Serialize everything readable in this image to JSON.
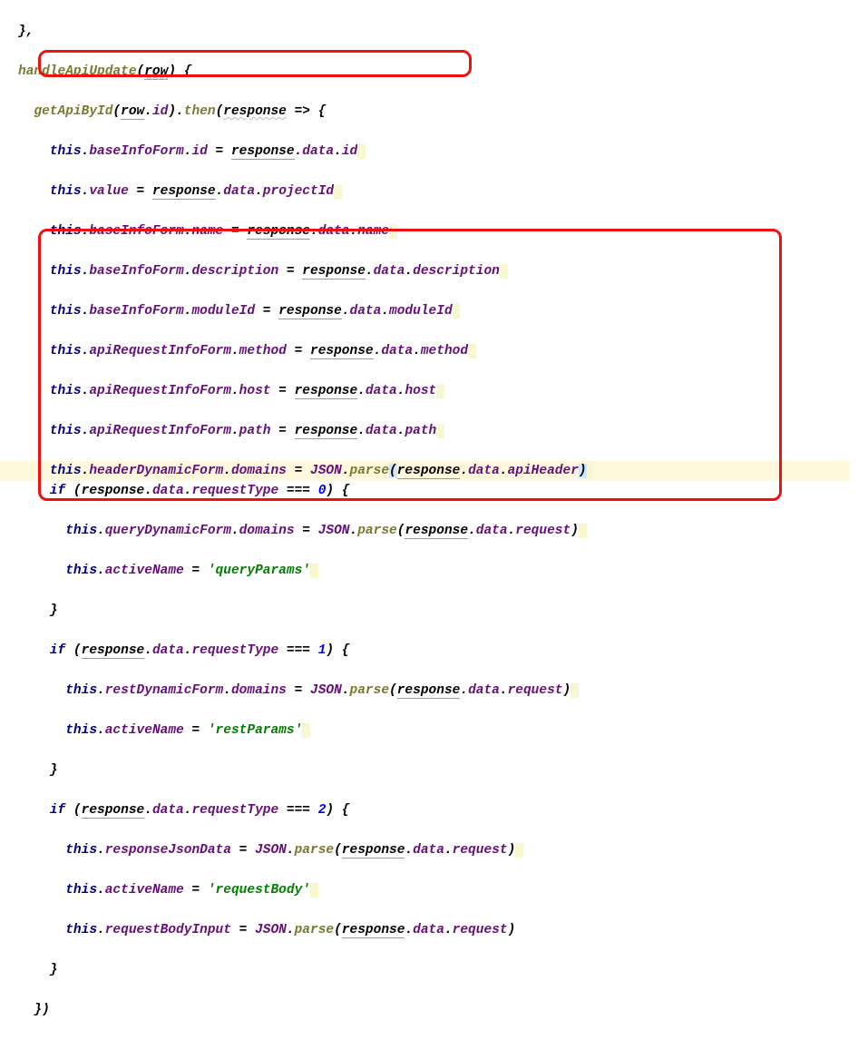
{
  "code": {
    "l0": "},",
    "l1_fn": "handleApiUpdate",
    "l1_arg": "row",
    "l2_fn": "getApiById",
    "l2_arg": "row",
    "l2_prop": "id",
    "l2_then": "then",
    "l2_resp": "response",
    "l3_this": "this",
    "l3_p1": "baseInfoForm",
    "l3_p2": "id",
    "l3_r": "response",
    "l3_rp1": "data",
    "l3_rp2": "id",
    "l4_this": "this",
    "l4_p1": "value",
    "l4_r": "response",
    "l4_rp1": "data",
    "l4_rp2": "projectId",
    "l5_this": "this",
    "l5_p1": "baseInfoForm",
    "l5_p2": "name",
    "l5_r": "response",
    "l5_rp1": "data",
    "l5_rp2": "name",
    "l6_this": "this",
    "l6_p1": "baseInfoForm",
    "l6_p2": "description",
    "l6_r": "response",
    "l6_rp1": "data",
    "l6_rp2": "description",
    "l7_this": "this",
    "l7_p1": "baseInfoForm",
    "l7_p2": "moduleId",
    "l7_r": "response",
    "l7_rp1": "data",
    "l7_rp2": "moduleId",
    "l8_this": "this",
    "l8_p1": "apiRequestInfoForm",
    "l8_p2": "method",
    "l8_r": "response",
    "l8_rp1": "data",
    "l8_rp2": "method",
    "l9_this": "this",
    "l9_p1": "apiRequestInfoForm",
    "l9_p2": "host",
    "l9_r": "response",
    "l9_rp1": "data",
    "l9_rp2": "host",
    "l10_this": "this",
    "l10_p1": "apiRequestInfoForm",
    "l10_p2": "path",
    "l10_r": "response",
    "l10_rp1": "data",
    "l10_rp2": "path",
    "l11_this": "this",
    "l11_p1": "headerDynamicForm",
    "l11_p2": "domains",
    "l11_json": "JSON",
    "l11_parse": "parse",
    "l11_r": "response",
    "l11_rp1": "data",
    "l11_rp2": "apiHeader",
    "l12_if": "if",
    "l12_r": "response",
    "l12_rp1": "data",
    "l12_rp2": "requestType",
    "l12_eq": "===",
    "l12_n": "0",
    "l13_this": "this",
    "l13_p1": "queryDynamicForm",
    "l13_p2": "domains",
    "l13_json": "JSON",
    "l13_parse": "parse",
    "l13_r": "response",
    "l13_rp1": "data",
    "l13_rp2": "request",
    "l14_this": "this",
    "l14_p1": "activeName",
    "l14_str": "'queryParams'",
    "l15": "}",
    "l16_if": "if",
    "l16_r": "response",
    "l16_rp1": "data",
    "l16_rp2": "requestType",
    "l16_eq": "===",
    "l16_n": "1",
    "l17_this": "this",
    "l17_p1": "restDynamicForm",
    "l17_p2": "domains",
    "l17_json": "JSON",
    "l17_parse": "parse",
    "l17_r": "response",
    "l17_rp1": "data",
    "l17_rp2": "request",
    "l18_this": "this",
    "l18_p1": "activeName",
    "l18_str": "'restParams'",
    "l19": "}",
    "l20_if": "if",
    "l20_r": "response",
    "l20_rp1": "data",
    "l20_rp2": "requestType",
    "l20_eq": "===",
    "l20_n": "2",
    "l21_this": "this",
    "l21_p1": "responseJsonData",
    "l21_json": "JSON",
    "l21_parse": "parse",
    "l21_r": "response",
    "l21_rp1": "data",
    "l21_rp2": "request",
    "l22_this": "this",
    "l22_p1": "activeName",
    "l22_str": "'requestBody'",
    "l23_this": "this",
    "l23_p1": "requestBodyInput",
    "l23_json": "JSON",
    "l23_parse": "parse",
    "l23_r": "response",
    "l23_rp1": "data",
    "l23_rp2": "request",
    "l24": "}",
    "l25": "})"
  }
}
